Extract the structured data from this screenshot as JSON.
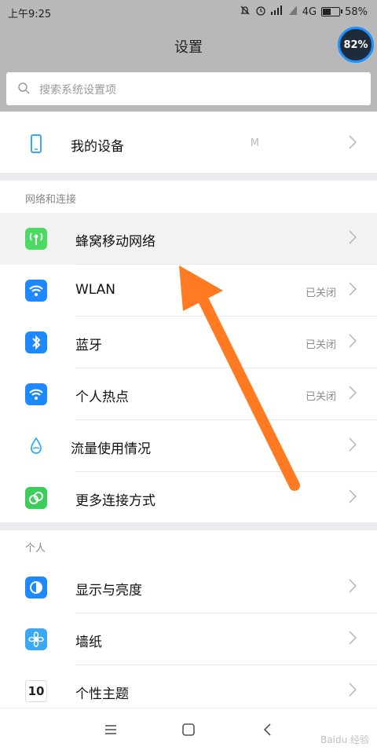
{
  "status_bar": {
    "time": "上午9:25",
    "network": "4G",
    "battery": "58%",
    "battery_level": 0.58
  },
  "header": {
    "title": "设置",
    "cleaner_percent": "82%"
  },
  "search": {
    "placeholder": "搜索系统设置项"
  },
  "device": {
    "label": "我的设备",
    "value": "M"
  },
  "sections": {
    "network_title": "网络和连接",
    "personal_title": "个人"
  },
  "network_items": [
    {
      "label": "蜂窝移动网络",
      "value": "",
      "icon": "cellular-icon",
      "color": "#4cd964"
    },
    {
      "label": "WLAN",
      "value": "已关闭",
      "icon": "wifi-icon",
      "color": "#1e88ff"
    },
    {
      "label": "蓝牙",
      "value": "已关闭",
      "icon": "bluetooth-icon",
      "color": "#1e88ff"
    },
    {
      "label": "个人热点",
      "value": "已关闭",
      "icon": "hotspot-icon",
      "color": "#1e88ff"
    },
    {
      "label": "流量使用情况",
      "value": "",
      "icon": "data-usage-icon",
      "color": "#ffffff"
    },
    {
      "label": "更多连接方式",
      "value": "",
      "icon": "more-connections-icon",
      "color": "#3ccd5a"
    }
  ],
  "personal_items": [
    {
      "label": "显示与亮度",
      "icon": "display-icon",
      "color": "#1e88ff"
    },
    {
      "label": "墙纸",
      "icon": "wallpaper-icon",
      "color": "#3aa8f5"
    },
    {
      "label": "个性主题",
      "icon": "theme-icon",
      "color": "#ffffff",
      "icon_text": "10"
    }
  ],
  "watermark": "Baidu 经验"
}
